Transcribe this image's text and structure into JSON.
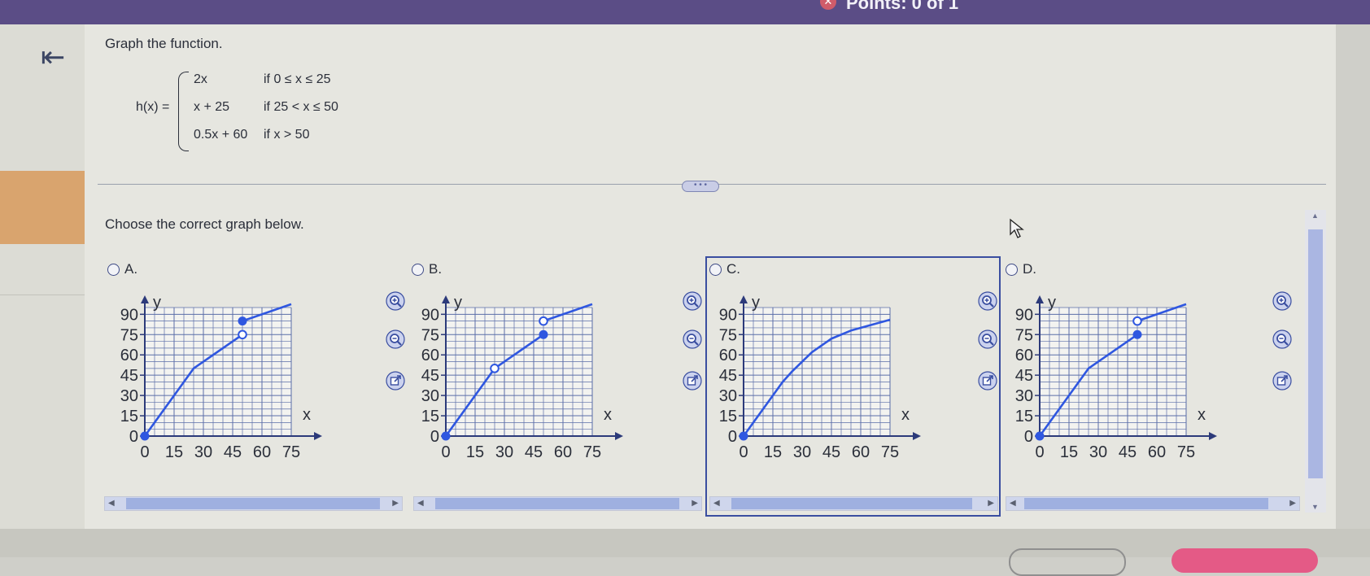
{
  "header": {
    "points_text": "Points: 0 of 1"
  },
  "question": {
    "prompt": "Graph the function.",
    "func_name": "h(x) =",
    "pieces": [
      {
        "expr": "2x",
        "cond": "if  0 ≤ x ≤ 25"
      },
      {
        "expr": "x + 25",
        "cond": "if  25 < x ≤ 50"
      },
      {
        "expr": "0.5x + 60",
        "cond": "if  x > 50"
      }
    ],
    "choose_text": "Choose the correct graph below.",
    "expand_label": "• • •"
  },
  "options": [
    {
      "letter": "A.",
      "selected": false
    },
    {
      "letter": "B.",
      "selected": false
    },
    {
      "letter": "C.",
      "selected": true
    },
    {
      "letter": "D.",
      "selected": false
    }
  ],
  "axis": {
    "y_label": "y",
    "x_label": "x",
    "y_ticks": [
      "90",
      "75",
      "60",
      "45",
      "30",
      "15",
      "0"
    ],
    "x_ticks": [
      "0",
      "15",
      "30",
      "45",
      "60",
      "75"
    ]
  },
  "icons": {
    "back": "back-to-start-icon",
    "zoom_in": "zoom-in-icon",
    "zoom_out": "zoom-out-icon",
    "popout": "popout-icon",
    "close": "close-x-icon"
  },
  "colors": {
    "curve": "#2f57e0",
    "grid": "#5b6ea8",
    "accent": "#3a4ea0",
    "top_bar": "#5b4d86",
    "highlight": "#d9a46e"
  },
  "chart_data": [
    {
      "type": "line",
      "title": "A.",
      "xlabel": "x",
      "ylabel": "y",
      "xlim": [
        0,
        75
      ],
      "ylim": [
        0,
        95
      ],
      "grid": true,
      "series": [
        {
          "values": [
            [
              0,
              0
            ],
            [
              25,
              50
            ],
            [
              50,
              75
            ]
          ]
        },
        {
          "values": [
            [
              50,
              85
            ],
            [
              75,
              97.5
            ]
          ]
        }
      ],
      "closed_points": [
        [
          0,
          0
        ],
        [
          50,
          85
        ]
      ],
      "open_points": [
        [
          50,
          75
        ]
      ]
    },
    {
      "type": "line",
      "title": "B.",
      "xlabel": "x",
      "ylabel": "y",
      "xlim": [
        0,
        75
      ],
      "ylim": [
        0,
        95
      ],
      "grid": true,
      "series": [
        {
          "values": [
            [
              0,
              0
            ],
            [
              25,
              50
            ]
          ]
        },
        {
          "values": [
            [
              25,
              50
            ],
            [
              50,
              75
            ]
          ]
        },
        {
          "values": [
            [
              50,
              85
            ],
            [
              75,
              97.5
            ]
          ]
        }
      ],
      "closed_points": [
        [
          0,
          0
        ],
        [
          50,
          75
        ]
      ],
      "open_points": [
        [
          25,
          50
        ],
        [
          50,
          85
        ]
      ]
    },
    {
      "type": "line",
      "title": "C.",
      "xlabel": "x",
      "ylabel": "y",
      "xlim": [
        0,
        75
      ],
      "ylim": [
        0,
        95
      ],
      "grid": true,
      "series": [
        {
          "values": [
            [
              0,
              0
            ],
            [
              10,
              20
            ],
            [
              20,
              40
            ],
            [
              25,
              48
            ],
            [
              35,
              62
            ],
            [
              45,
              72
            ],
            [
              55,
              78
            ],
            [
              65,
              82
            ],
            [
              75,
              86
            ]
          ]
        }
      ],
      "closed_points": [
        [
          0,
          0
        ]
      ],
      "open_points": []
    },
    {
      "type": "line",
      "title": "D.",
      "xlabel": "x",
      "ylabel": "y",
      "xlim": [
        0,
        75
      ],
      "ylim": [
        0,
        95
      ],
      "grid": true,
      "series": [
        {
          "values": [
            [
              0,
              0
            ],
            [
              25,
              50
            ],
            [
              50,
              75
            ]
          ]
        },
        {
          "values": [
            [
              50,
              85
            ],
            [
              75,
              97.5
            ]
          ]
        }
      ],
      "closed_points": [
        [
          0,
          0
        ],
        [
          50,
          75
        ]
      ],
      "open_points": [
        [
          50,
          85
        ]
      ]
    }
  ]
}
